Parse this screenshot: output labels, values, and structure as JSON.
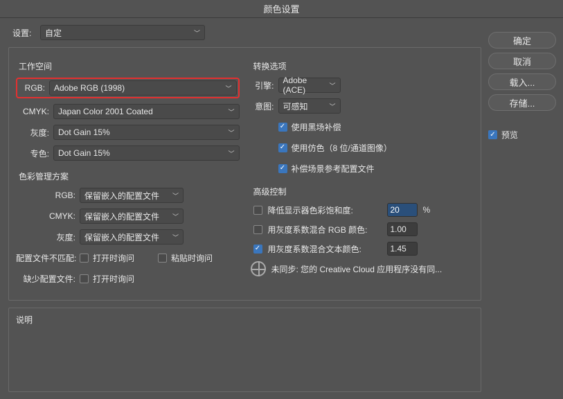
{
  "title": "颜色设置",
  "settings": {
    "label": "设置:",
    "value": "自定"
  },
  "workspace": {
    "legend": "工作空间",
    "rgb_label": "RGB:",
    "rgb_value": "Adobe RGB (1998)",
    "cmyk_label": "CMYK:",
    "cmyk_value": "Japan Color 2001 Coated",
    "gray_label": "灰度:",
    "gray_value": "Dot Gain 15%",
    "spot_label": "专色:",
    "spot_value": "Dot Gain 15%"
  },
  "convert": {
    "legend": "转换选项",
    "engine_label": "引擎:",
    "engine_value": "Adobe (ACE)",
    "intent_label": "意图:",
    "intent_value": "可感知",
    "cb_blackpoint": "使用黑场补偿",
    "cb_dither": "使用仿色（8 位/通道图像）",
    "cb_scene": "补偿场景参考配置文件"
  },
  "policies": {
    "legend": "色彩管理方案",
    "rgb_label": "RGB:",
    "rgb_value": "保留嵌入的配置文件",
    "cmyk_label": "CMYK:",
    "cmyk_value": "保留嵌入的配置文件",
    "gray_label": "灰度:",
    "gray_value": "保留嵌入的配置文件",
    "mismatch_label": "配置文件不匹配:",
    "mismatch_open": "打开时询问",
    "mismatch_paste": "粘贴时询问",
    "missing_label": "缺少配置文件:",
    "missing_open": "打开时询问"
  },
  "advanced": {
    "legend": "高级控制",
    "desaturate_label": "降低显示器色彩饱和度:",
    "desaturate_value": "20",
    "desaturate_unit": "%",
    "blend_rgb_label": "用灰度系数混合 RGB 颜色:",
    "blend_rgb_value": "1.00",
    "blend_text_label": "用灰度系数混合文本颜色:",
    "blend_text_value": "1.45"
  },
  "sync": "未同步: 您的 Creative Cloud 应用程序没有同...",
  "buttons": {
    "ok": "确定",
    "cancel": "取消",
    "load": "载入...",
    "save": "存储..."
  },
  "preview_label": "预览",
  "description_label": "说明"
}
